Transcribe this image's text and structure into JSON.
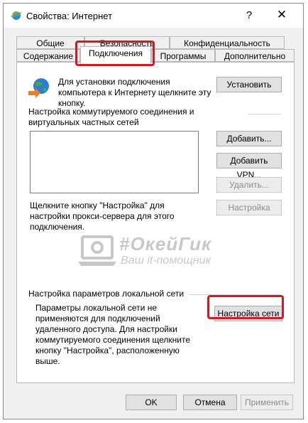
{
  "window": {
    "title": "Свойства: Интернет",
    "help_label": "?",
    "close_label": "✕"
  },
  "tabs_row1": [
    {
      "label": "Общие"
    },
    {
      "label": "Безопасность"
    },
    {
      "label": "Конфиденциальность"
    }
  ],
  "tabs_row2": [
    {
      "label": "Содержание"
    },
    {
      "label": "Подключения",
      "active": true
    },
    {
      "label": "Программы"
    },
    {
      "label": "Дополнительно"
    }
  ],
  "setup": {
    "text": "Для установки подключения компьютера к Интернету щелкните эту кнопку.",
    "button": "Установить"
  },
  "dialup": {
    "heading": "Настройка коммутируемого соединения и виртуальных частных сетей",
    "add": "Добавить...",
    "add_vpn": "Добавить VPN...",
    "remove": "Удалить...",
    "settings": "Настройка",
    "hint": "Щелкните кнопку \"Настройка\" для настройки прокси-сервера для этого подключения."
  },
  "watermark": {
    "title": "#ОкейГик",
    "subtitle": "Ваш it-помощник"
  },
  "lan": {
    "heading": "Настройка параметров локальной сети",
    "text": "Параметры локальной сети не применяются для подключений удаленного доступа. Для настройки коммутируемого соединения щелкните кнопку \"Настройка\", расположенную выше.",
    "button": "Настройка сети"
  },
  "footer": {
    "ok": "OK",
    "cancel": "Отмена",
    "apply": "Применить"
  },
  "colors": {
    "highlight": "#d01b25",
    "dialog_bg": "#f0f0f0"
  }
}
